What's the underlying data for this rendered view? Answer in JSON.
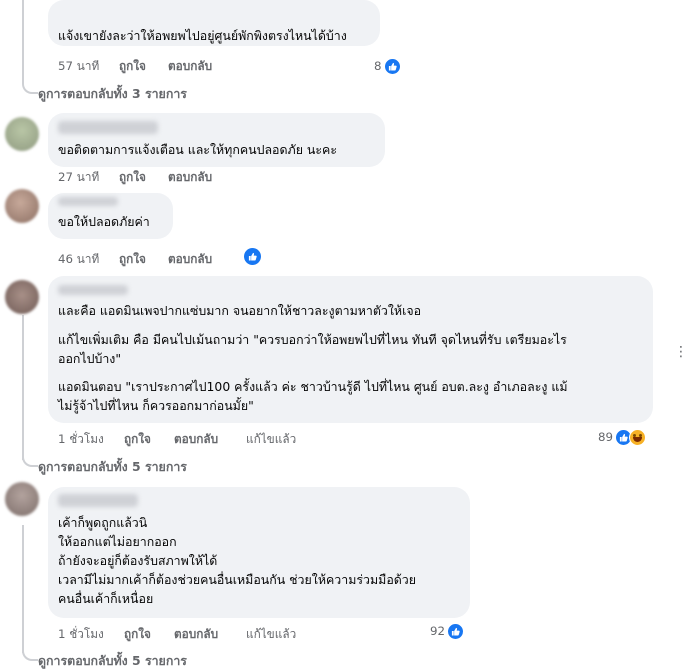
{
  "colors": {
    "bubble": "#f0f2f5",
    "like_blue": "#1877f2",
    "meta_gray": "#65676b",
    "haha_yellow": "#f7b125"
  },
  "actions": {
    "like": "ถูกใจ",
    "reply": "ตอบกลับ",
    "edited": "แก้ไขแล้ว"
  },
  "comments": [
    {
      "lines": [
        "แจ้งเขายังละว่าให้อพยพไปอยู่ศูนย์พักพิงตรงไหนได้บ้าง"
      ],
      "time": "57 นาที",
      "reactions": "8",
      "reaction_icons": [
        "like-icon"
      ]
    },
    {
      "lines": [
        "ขอติดตามการแจ้งเตือน และให้ทุกคนปลอดภัย นะคะ"
      ],
      "time": "27 นาที",
      "reactions": "",
      "reaction_icons": []
    },
    {
      "lines": [
        "ขอให้ปลอดภัยค่า"
      ],
      "time": "46 นาที",
      "reactions": "",
      "reaction_icons": [
        "like-icon"
      ]
    },
    {
      "lines": [
        "และคือ แอดมินเพจปากแซ่บมาก จนอยากให้ชาวละงูตามหาตัวให้เจอ",
        "แก้ไขเพิ่มเติม คือ มีคนไปเม้นถามว่า \"ควรบอกว่าให้อพยพไปที่ไหน ทันที จุดไหนที่รับ เตรียมอะไร",
        "ออกไปบ้าง\"",
        "แอดมินตอบ \"เราประกาศไป100 ครั้งแล้ว ค่ะ ชาวบ้านรู้ดี ไปที่ไหน ศูนย์ อบต.ละงู อำเภอละงู แม้",
        "ไม่รู้จ้าไปที่ไหน ก็ควรออกมาก่อนมั้ย\""
      ],
      "time": "1 ชั่วโมง",
      "edited": true,
      "reactions": "89",
      "reaction_icons": [
        "like-icon",
        "haha-icon"
      ]
    },
    {
      "lines": [
        "เค้าก็พูดถูกแล้วนิ",
        "ให้ออกแต่ไม่อยากออก",
        "ถ้ายังจะอยู่ก็ต้องรับสภาพให้ได้",
        "เวลามีไม่มากเค้าก็ต้องช่วยคนอื่นเหมือนกัน ช่วยให้ความร่วมมือด้วย",
        "คนอื่นเค้าก็เหนื่อย"
      ],
      "time": "1 ชั่วโมง",
      "edited": true,
      "reactions": "92",
      "reaction_icons": [
        "like-icon"
      ]
    }
  ],
  "view_replies": [
    "ดูการตอบกลับทั้ง 3 รายการ",
    "ดูการตอบกลับทั้ง 5 รายการ",
    "ดูการตอบกลับทั้ง 5 รายการ"
  ]
}
